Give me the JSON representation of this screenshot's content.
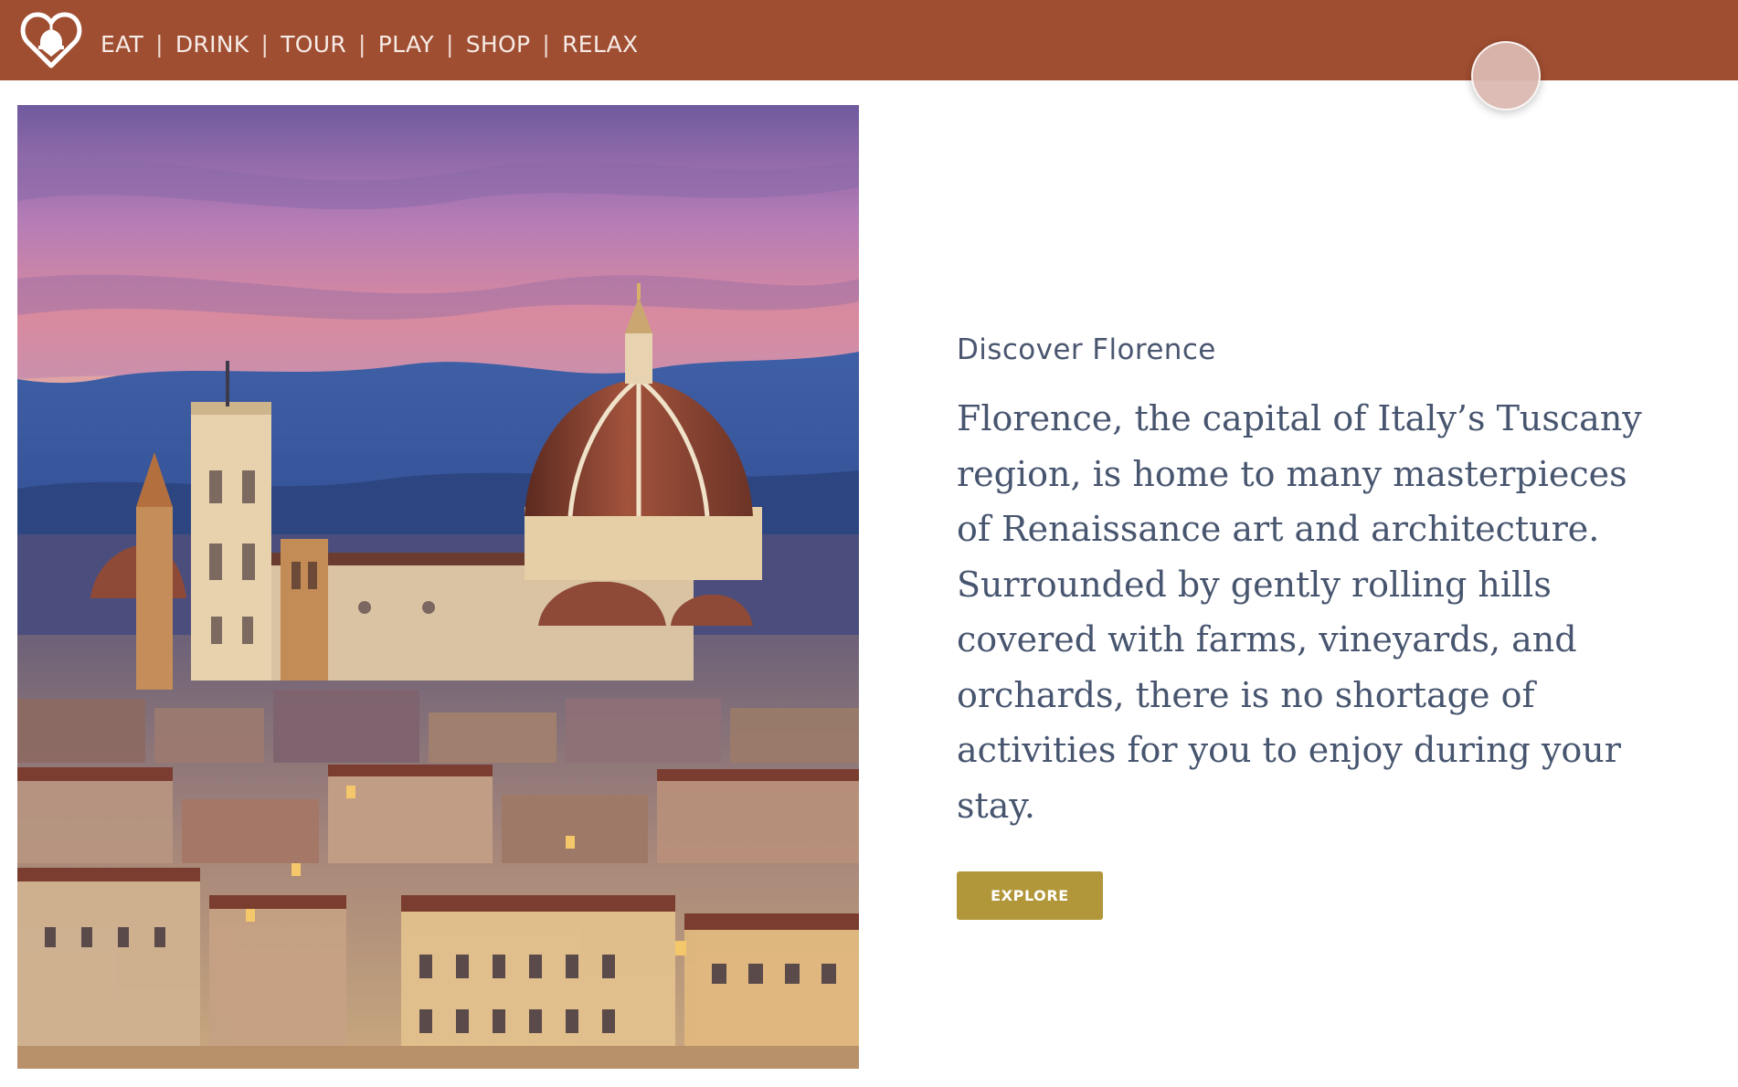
{
  "header": {
    "logo_icon": "heart-dome-logo-icon",
    "nav": [
      {
        "label": "EAT"
      },
      {
        "label": "DRINK"
      },
      {
        "label": "TOUR"
      },
      {
        "label": "PLAY"
      },
      {
        "label": "SHOP"
      },
      {
        "label": "RELAX"
      }
    ],
    "separator": "|"
  },
  "hero_image": {
    "subject": "florence-cathedral-skyline-photo"
  },
  "content": {
    "eyebrow": "Discover Florence",
    "body": "Florence, the capital of Italy’s Tuscany region, is home to many masterpieces of Renaissance art and architecture. Surrounded by gently rolling hills covered with farms, vineyards, and orchards, there is no shortage of activities for you to enjoy during your stay.",
    "button_label": "EXPLORE"
  },
  "colors": {
    "header_bg": "#a04e31",
    "text": "#47556f",
    "button_bg": "#b2973a"
  }
}
